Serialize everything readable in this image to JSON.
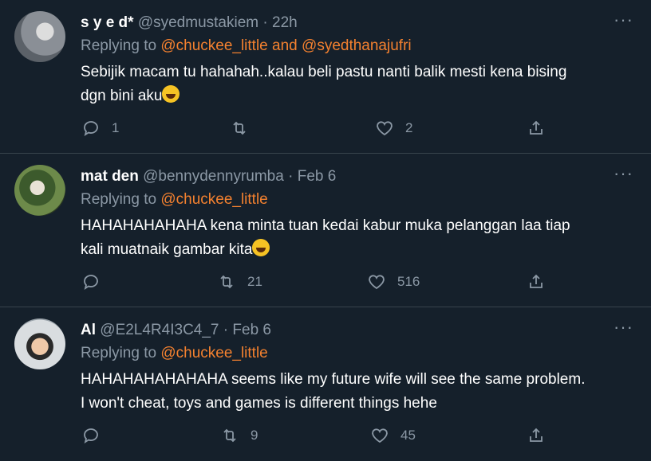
{
  "tweets": [
    {
      "name": "s y e d*",
      "handle": "@syedmustakiem",
      "sep": "·",
      "time": "22h",
      "replying_prefix": "Replying to ",
      "mention1": "@chuckee_little",
      "mention_and": " and ",
      "mention2": "@syedthanajufri",
      "body1": "Sebijik macam tu hahahah..kalau beli pastu nanti balik mesti kena bising",
      "body2": "dgn bini aku",
      "emoji": "joy-emoji",
      "reply_count": "1",
      "retweet_count": "",
      "like_count": "2"
    },
    {
      "name": "mat den",
      "handle": "@bennydennyrumba",
      "sep": "·",
      "time": "Feb 6",
      "replying_prefix": "Replying to ",
      "mention1": "@chuckee_little",
      "body1": "HAHAHAHAHAHA kena minta tuan kedai kabur muka pelanggan laa tiap",
      "body2": "kali muatnaik gambar kita",
      "emoji": "rofl-emoji",
      "reply_count": "",
      "retweet_count": "21",
      "like_count": "516"
    },
    {
      "name": "Al",
      "handle": "@E2L4R4I3C4_7",
      "sep": "·",
      "time": "Feb 6",
      "replying_prefix": "Replying to ",
      "mention1": "@chuckee_little",
      "body1": "HAHAHAHAHAHAHA seems like my future wife will see the same problem.",
      "body2": "I won't cheat, toys and games is different things hehe",
      "reply_count": "",
      "retweet_count": "9",
      "like_count": "45"
    }
  ],
  "icons": {
    "more": "more-horizontal-icon",
    "reply": "reply-icon",
    "retweet": "retweet-icon",
    "like": "heart-icon",
    "share": "share-icon"
  },
  "colors": {
    "background": "#15202b",
    "mention": "#f4812f",
    "muted": "#8b98a5",
    "divider": "#38444d"
  }
}
